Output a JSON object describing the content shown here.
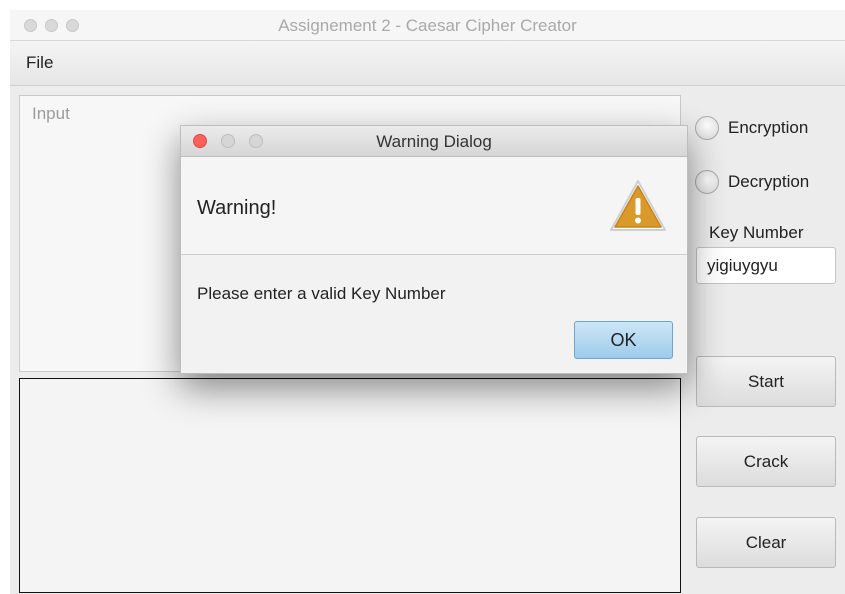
{
  "window": {
    "title": "Assignement 2 - Caesar Cipher Creator"
  },
  "menubar": {
    "file": "File"
  },
  "input": {
    "placeholder": "Input",
    "value": ""
  },
  "output": {
    "value": ""
  },
  "options": {
    "encryption_label": "Encryption",
    "encryption_selected": false,
    "decryption_label": "Decryption",
    "decryption_selected": false
  },
  "key": {
    "label": "Key Number",
    "value": "yigiuygyu"
  },
  "buttons": {
    "start": "Start",
    "crack": "Crack",
    "clear": "Clear"
  },
  "dialog": {
    "title": "Warning Dialog",
    "heading": "Warning!",
    "message": "Please enter a valid Key Number",
    "ok": "OK",
    "icon": "warning-triangle-icon"
  },
  "colors": {
    "warning_icon": "#d99a2b",
    "close_red": "#fc605c",
    "ok_blue": "#9ecbea"
  }
}
